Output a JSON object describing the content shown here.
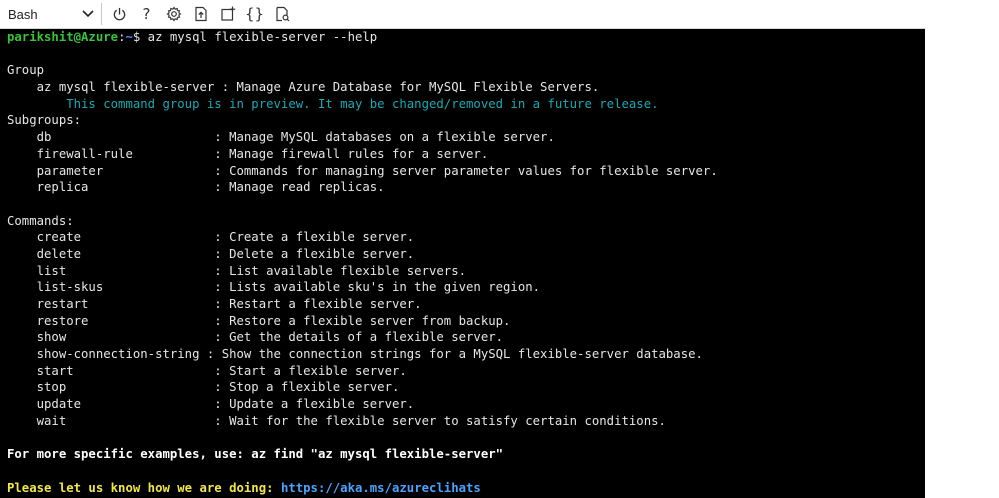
{
  "toolbar": {
    "shell": "Bash",
    "icons": [
      "power-icon",
      "help-icon",
      "settings-icon",
      "upload-download-icon",
      "new-session-icon",
      "editor-icon",
      "web-preview-icon"
    ],
    "help_glyph": "?",
    "braces_glyph": "{}"
  },
  "terminal": {
    "prompt_user": "parikshit@Azure",
    "prompt_sep": ":",
    "prompt_path": "~",
    "prompt_symbol": "$",
    "command": " az mysql flexible-server --help",
    "group_heading": "Group",
    "group_line": "    az mysql flexible-server : Manage Azure Database for MySQL Flexible Servers.",
    "preview_line": "        This command group is in preview. It may be changed/removed in a future release.",
    "subgroups_heading": "Subgroups:",
    "subgroups": [
      "    db                      : Manage MySQL databases on a flexible server.",
      "    firewall-rule           : Manage firewall rules for a server.",
      "    parameter               : Commands for managing server parameter values for flexible server.",
      "    replica                 : Manage read replicas."
    ],
    "commands_heading": "Commands:",
    "commands": [
      "    create                  : Create a flexible server.",
      "    delete                  : Delete a flexible server.",
      "    list                    : List available flexible servers.",
      "    list-skus               : Lists available sku's in the given region.",
      "    restart                 : Restart a flexible server.",
      "    restore                 : Restore a flexible server from backup.",
      "    show                    : Get the details of a flexible server.",
      "    show-connection-string : Show the connection strings for a MySQL flexible-server database.",
      "    start                   : Start a flexible server.",
      "    stop                    : Stop a flexible server.",
      "    update                  : Update a flexible server.",
      "    wait                    : Wait for the flexible server to satisfy certain conditions."
    ],
    "examples_line": "For more specific examples, use: az find \"az mysql flexible-server\"",
    "feedback_label": "Please let us know how we are doing: ",
    "feedback_link": "https://aka.ms/azureclihats"
  },
  "colors": {
    "prompt_user": "#3ac23a",
    "prompt_path": "#4a8cff",
    "preview": "#19a9b5",
    "feedback": "#f2e74a",
    "link": "#4aa3ff",
    "terminal_bg": "#000000"
  }
}
